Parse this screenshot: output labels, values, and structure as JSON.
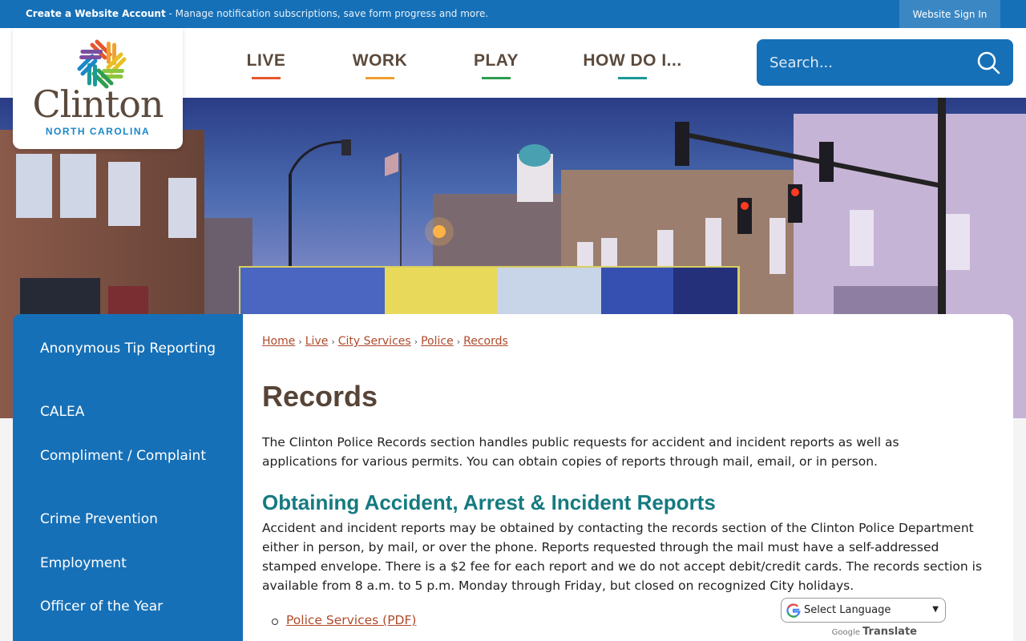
{
  "topbar": {
    "create_account": "Create a Website Account",
    "message": " - Manage notification subscriptions, save form progress and more.",
    "sign_in": "Website Sign In"
  },
  "logo": {
    "name": "Clinton",
    "subtitle": "NORTH CAROLINA"
  },
  "nav": {
    "items": [
      {
        "label": "LIVE",
        "color": "#e4572e"
      },
      {
        "label": "WORK",
        "color": "#f0a030"
      },
      {
        "label": "PLAY",
        "color": "#2e9d50"
      },
      {
        "label": "HOW DO I...",
        "color": "#1a9a98"
      }
    ]
  },
  "search": {
    "placeholder": "Search..."
  },
  "sidebar": {
    "items": [
      "Anonymous Tip Reporting",
      "CALEA",
      "Compliment / Complaint",
      "Crime Prevention",
      "Employment",
      "Officer of the Year"
    ]
  },
  "breadcrumb": [
    "Home",
    "Live",
    "City Services",
    "Police",
    "Records"
  ],
  "page": {
    "title": "Records",
    "intro": "The Clinton Police Records section handles public requests for accident and incident reports as well as applications for various permits. You can obtain copies of reports through mail, email, or in person.",
    "section_heading": "Obtaining Accident, Arrest & Incident Reports",
    "section_body": "Accident and incident reports may be obtained by contacting the records section of the Clinton Police Department either in person, by mail, or over the phone. Reports requested through the mail must have a self-addressed stamped envelope. There is a $2 fee for each report and we do not accept debit/credit cards. The records section is available from 8 a.m. to 5 p.m. Monday through Friday, but closed on recognized City holidays.",
    "link": "Police Services (PDF)"
  },
  "translate": {
    "select_label": "Select Language",
    "powered_by": "Google",
    "translate": "Translate"
  },
  "colors": {
    "brand_blue": "#1670b7",
    "heading_brown": "#574437",
    "section_teal": "#157a80",
    "link_red": "#b04a2b"
  }
}
